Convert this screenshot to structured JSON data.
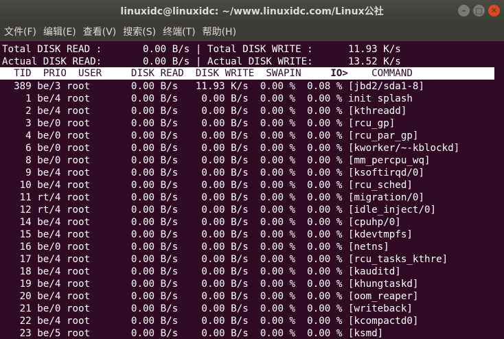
{
  "window": {
    "title": "linuxidc@linuxidc: ~/www.linuxidc.com/Linux公社",
    "buttons": {
      "minimize": "–",
      "maximize": "□",
      "close": "✕"
    }
  },
  "menu": [
    "文件(F)",
    "编辑(E)",
    "查看(V)",
    "搜索(S)",
    "终端(T)",
    "帮助(H)"
  ],
  "summary": {
    "line1": "Total DISK READ :       0.00 B/s | Total DISK WRITE :      11.93 K/s",
    "line2": "Actual DISK READ:       0.00 B/s | Actual DISK WRITE:      13.52 K/s"
  },
  "columns": {
    "pre": "  TID  PRIO  USER     DISK READ  DISK WRITE  SWAPIN     ",
    "sorted": "IO>",
    "post": "    COMMAND"
  },
  "rows": [
    {
      "tid": "389",
      "prio": "be/3",
      "user": "root",
      "read": "0.00 B/s",
      "write": "11.93 K/s",
      "swapin": "0.00 %",
      "io": "0.08 %",
      "cmd": "[jbd2/sda1-8]"
    },
    {
      "tid": "1",
      "prio": "be/4",
      "user": "root",
      "read": "0.00 B/s",
      "write": "0.00 B/s",
      "swapin": "0.00 %",
      "io": "0.00 %",
      "cmd": "init splash"
    },
    {
      "tid": "2",
      "prio": "be/4",
      "user": "root",
      "read": "0.00 B/s",
      "write": "0.00 B/s",
      "swapin": "0.00 %",
      "io": "0.00 %",
      "cmd": "[kthreadd]"
    },
    {
      "tid": "3",
      "prio": "be/0",
      "user": "root",
      "read": "0.00 B/s",
      "write": "0.00 B/s",
      "swapin": "0.00 %",
      "io": "0.00 %",
      "cmd": "[rcu_gp]"
    },
    {
      "tid": "4",
      "prio": "be/0",
      "user": "root",
      "read": "0.00 B/s",
      "write": "0.00 B/s",
      "swapin": "0.00 %",
      "io": "0.00 %",
      "cmd": "[rcu_par_gp]"
    },
    {
      "tid": "6",
      "prio": "be/0",
      "user": "root",
      "read": "0.00 B/s",
      "write": "0.00 B/s",
      "swapin": "0.00 %",
      "io": "0.00 %",
      "cmd": "[kworker/~-kblockd]"
    },
    {
      "tid": "8",
      "prio": "be/0",
      "user": "root",
      "read": "0.00 B/s",
      "write": "0.00 B/s",
      "swapin": "0.00 %",
      "io": "0.00 %",
      "cmd": "[mm_percpu_wq]"
    },
    {
      "tid": "9",
      "prio": "be/4",
      "user": "root",
      "read": "0.00 B/s",
      "write": "0.00 B/s",
      "swapin": "0.00 %",
      "io": "0.00 %",
      "cmd": "[ksoftirqd/0]"
    },
    {
      "tid": "10",
      "prio": "be/4",
      "user": "root",
      "read": "0.00 B/s",
      "write": "0.00 B/s",
      "swapin": "0.00 %",
      "io": "0.00 %",
      "cmd": "[rcu_sched]"
    },
    {
      "tid": "11",
      "prio": "rt/4",
      "user": "root",
      "read": "0.00 B/s",
      "write": "0.00 B/s",
      "swapin": "0.00 %",
      "io": "0.00 %",
      "cmd": "[migration/0]"
    },
    {
      "tid": "12",
      "prio": "rt/4",
      "user": "root",
      "read": "0.00 B/s",
      "write": "0.00 B/s",
      "swapin": "0.00 %",
      "io": "0.00 %",
      "cmd": "[idle_inject/0]"
    },
    {
      "tid": "14",
      "prio": "be/4",
      "user": "root",
      "read": "0.00 B/s",
      "write": "0.00 B/s",
      "swapin": "0.00 %",
      "io": "0.00 %",
      "cmd": "[cpuhp/0]"
    },
    {
      "tid": "15",
      "prio": "be/4",
      "user": "root",
      "read": "0.00 B/s",
      "write": "0.00 B/s",
      "swapin": "0.00 %",
      "io": "0.00 %",
      "cmd": "[kdevtmpfs]"
    },
    {
      "tid": "16",
      "prio": "be/0",
      "user": "root",
      "read": "0.00 B/s",
      "write": "0.00 B/s",
      "swapin": "0.00 %",
      "io": "0.00 %",
      "cmd": "[netns]"
    },
    {
      "tid": "17",
      "prio": "be/4",
      "user": "root",
      "read": "0.00 B/s",
      "write": "0.00 B/s",
      "swapin": "0.00 %",
      "io": "0.00 %",
      "cmd": "[rcu_tasks_kthre]"
    },
    {
      "tid": "18",
      "prio": "be/4",
      "user": "root",
      "read": "0.00 B/s",
      "write": "0.00 B/s",
      "swapin": "0.00 %",
      "io": "0.00 %",
      "cmd": "[kauditd]"
    },
    {
      "tid": "19",
      "prio": "be/4",
      "user": "root",
      "read": "0.00 B/s",
      "write": "0.00 B/s",
      "swapin": "0.00 %",
      "io": "0.00 %",
      "cmd": "[khungtaskd]"
    },
    {
      "tid": "20",
      "prio": "be/4",
      "user": "root",
      "read": "0.00 B/s",
      "write": "0.00 B/s",
      "swapin": "0.00 %",
      "io": "0.00 %",
      "cmd": "[oom_reaper]"
    },
    {
      "tid": "21",
      "prio": "be/0",
      "user": "root",
      "read": "0.00 B/s",
      "write": "0.00 B/s",
      "swapin": "0.00 %",
      "io": "0.00 %",
      "cmd": "[writeback]"
    },
    {
      "tid": "22",
      "prio": "be/4",
      "user": "root",
      "read": "0.00 B/s",
      "write": "0.00 B/s",
      "swapin": "0.00 %",
      "io": "0.00 %",
      "cmd": "[kcompactd0]"
    },
    {
      "tid": "23",
      "prio": "be/5",
      "user": "root",
      "read": "0.00 B/s",
      "write": "0.00 B/s",
      "swapin": "0.00 %",
      "io": "0.00 %",
      "cmd": "[ksmd]"
    }
  ],
  "colors": {
    "terminal_bg": "#300a24",
    "close_button": "#df4a16",
    "header_bg": "#ffffff"
  }
}
